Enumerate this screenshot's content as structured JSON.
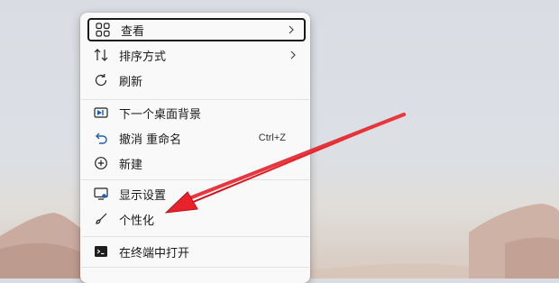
{
  "context_menu": {
    "items": [
      {
        "label": "查看",
        "icon": "grid-icon",
        "submenu": true
      },
      {
        "label": "排序方式",
        "icon": "sort-icon",
        "submenu": true
      },
      {
        "label": "刷新",
        "icon": "refresh-icon"
      },
      {
        "label": "下一个桌面背景",
        "icon": "next-background-icon"
      },
      {
        "label": "撤消 重命名",
        "icon": "undo-icon",
        "shortcut": "Ctrl+Z"
      },
      {
        "label": "新建",
        "icon": "add-circle-icon"
      },
      {
        "label": "显示设置",
        "icon": "display-settings-icon"
      },
      {
        "label": "个性化",
        "icon": "brush-icon"
      },
      {
        "label": "在终端中打开",
        "icon": "terminal-icon"
      }
    ]
  },
  "annotation": {
    "color": "#e8212a",
    "icon": "red-arrow-pointing-to-personalize"
  }
}
